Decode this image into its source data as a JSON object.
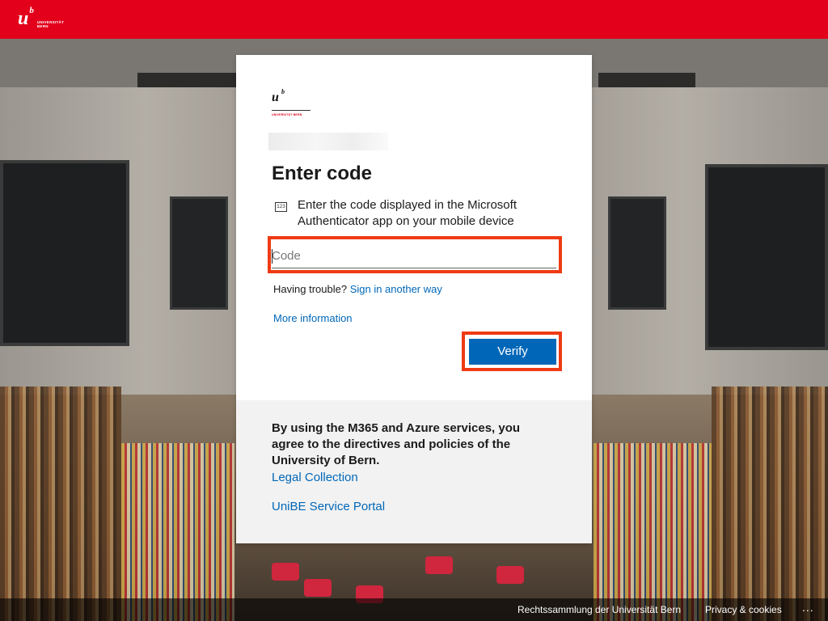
{
  "topbar": {
    "logo_letter": "u",
    "logo_superscript": "b",
    "logo_text_line1": "UNIVERSITÄT",
    "logo_text_line2": "BERN",
    "brand_color": "#e3001b"
  },
  "card": {
    "brand_letter": "u",
    "brand_superscript": "b",
    "brand_text": "UNIVERSITÄT BERN",
    "title": "Enter code",
    "hint_icon": "123",
    "hint_icon_name": "authenticator-code-icon",
    "hint_text": "Enter the code displayed in the Microsoft Authenticator app on your mobile device",
    "code_input": {
      "placeholder": "Code",
      "value": ""
    },
    "trouble_prefix": "Having trouble?",
    "trouble_link": "Sign in another way",
    "more_info": "More information",
    "verify_label": "Verify",
    "accent_color": "#0067b8",
    "highlight_color": "#ef3a14"
  },
  "footer": {
    "policy_text": "By using the M365 and Azure services, you agree to the directives and policies of the University of Bern.",
    "legal_link": "Legal Collection",
    "portal_link": "UniBE Service Portal"
  },
  "bottom_bar": {
    "link1": "Rechtssammlung der Universität Bern",
    "link2": "Privacy & cookies",
    "more": "..."
  }
}
